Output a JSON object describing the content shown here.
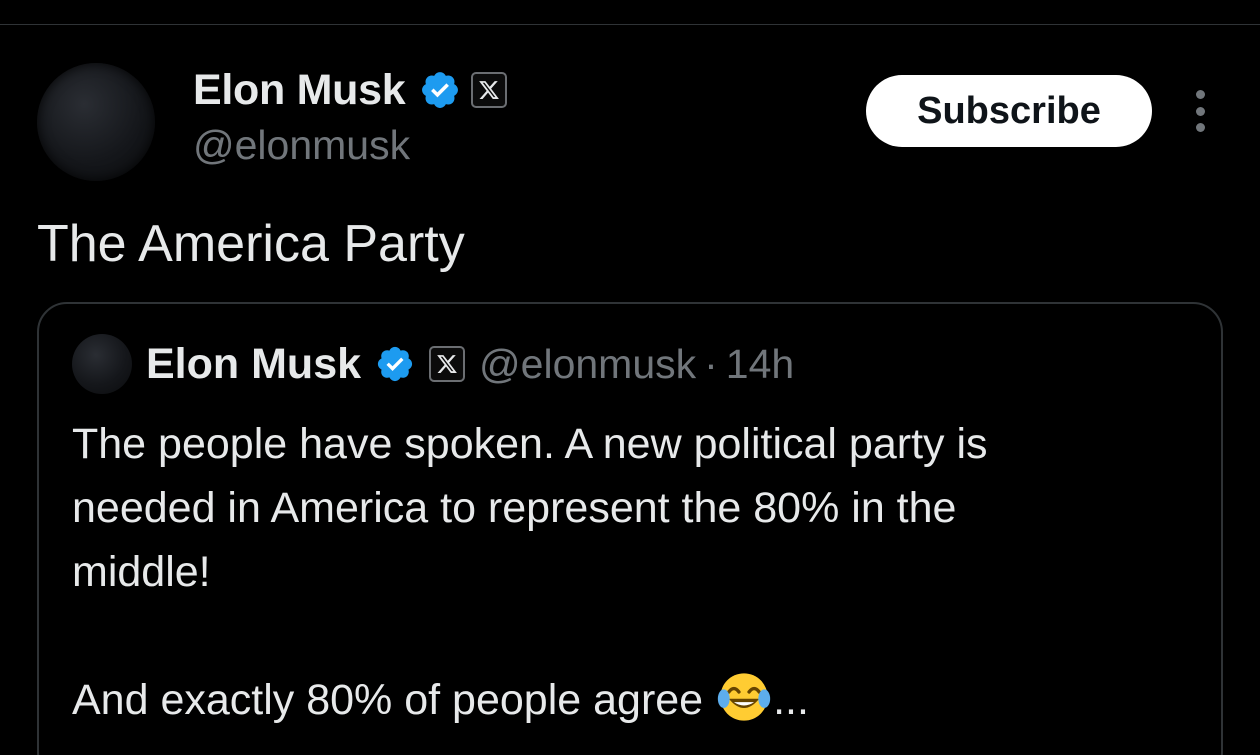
{
  "post": {
    "author_name": "Elon Musk",
    "author_handle": "@elonmusk",
    "subscribe_label": "Subscribe",
    "text": "The America Party",
    "avatar_icon": "avatar-dark-sphere",
    "verified_icon": "verified-badge-icon",
    "affiliate_icon": "x-logo-icon",
    "more_icon": "more-vertical-icon"
  },
  "quoted_post": {
    "author_name": "Elon Musk",
    "author_handle": "@elonmusk",
    "separator": "·",
    "timestamp": "14h",
    "lines": [
      "The people have spoken. A new political party is",
      "needed in America to represent the 80% in the",
      "middle!"
    ],
    "last_line_before_emoji": "And exactly 80% of people agree ",
    "emoji_icon": "face-with-tears-of-joy-emoji",
    "last_line_after_emoji": "..."
  },
  "colors": {
    "background": "#000000",
    "text_primary": "#e7e9ea",
    "text_secondary": "#71767b",
    "verified_blue": "#1d9bf0",
    "border": "#2f3336",
    "button_bg": "#ffffff",
    "button_text": "#0f1419"
  }
}
